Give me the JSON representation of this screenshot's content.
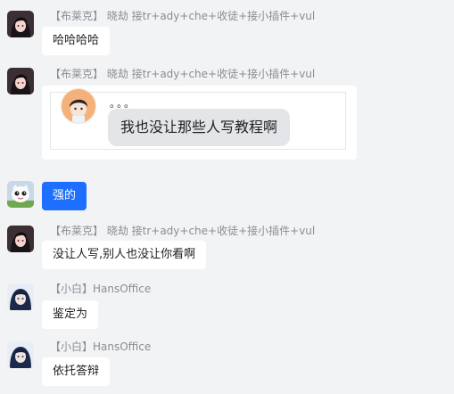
{
  "messages": [
    {
      "sender": "【布莱克】 晓劫 接tr+ady+che+收徒+接小插件+vul",
      "text": "哈哈哈哈"
    },
    {
      "sender": "【布莱克】 晓劫 接tr+ady+che+收徒+接小插件+vul",
      "quote_dots": "。。。",
      "quote_text": "我也没让那些人写教程啊"
    },
    {
      "text": "强的"
    },
    {
      "sender": "【布莱克】 晓劫 接tr+ady+che+收徒+接小插件+vul",
      "text": "没让人写,别人也没让你看啊"
    },
    {
      "sender": "【小白】HansOffice",
      "text": "鉴定为"
    },
    {
      "sender": "【小白】HansOffice",
      "text": "依托答辩"
    }
  ],
  "colors": {
    "background": "#f2f3f5",
    "self_bubble": "#1e6fff",
    "other_bubble": "#ffffff",
    "sender_text": "#8a8d93"
  },
  "avatars": [
    "black-haired-avatar",
    "black-haired-avatar",
    "cat-avatar",
    "black-haired-avatar",
    "blue-hair-avatar",
    "blue-hair-avatar"
  ]
}
